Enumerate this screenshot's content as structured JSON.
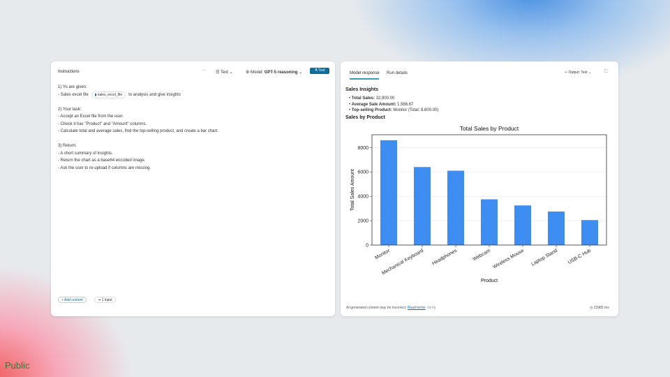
{
  "left": {
    "title": "Instructions",
    "more": "···",
    "format": "Text",
    "model_label": "Model:",
    "model": "GPT-5 reasoning",
    "test": "Test",
    "lines": [
      "1) Yo are given:",
      "- Sales excel file",
      "to analysis and give insights",
      "",
      "2) Your task:",
      "- Accept an Excel file from the user.",
      "- Check it has \"Product\" and \"Amount\" columns.",
      "- Calculate total and average sales, find the top-selling product, and create a bar chart.",
      "",
      "3) Return:",
      "- A short summary of insights.",
      "- Return the chart as a base64 encoded image.",
      "- Ask the user to re-upload if columns are missing."
    ],
    "file_chip": "sales_excel_file",
    "add_content": "Add content",
    "inputs": "1 input"
  },
  "right": {
    "tabs": [
      "Model response",
      "Run details"
    ],
    "output_label": "Output:",
    "output_value": "Text",
    "heading": "Sales Insights",
    "bullets": [
      {
        "k": "Total Sales:",
        "v": "32,900.00"
      },
      {
        "k": "Average Sale Amount:",
        "v": "1,566.67"
      },
      {
        "k": "Top-selling Product:",
        "v": "Monitor (Total: 8,600.00)"
      }
    ],
    "subheading": "Sales by Product",
    "disclaimer": "AI-generated content may be incorrect.",
    "read_terms": "Read terms",
    "time": "23985 ms"
  },
  "chart_data": {
    "type": "bar",
    "title": "Total Sales by Product",
    "xlabel": "Product",
    "ylabel": "Total Sales Amount",
    "categories": [
      "Monitor",
      "Mechanical Keyboard",
      "Headphones",
      "Webcam",
      "Wireless Mouse",
      "Laptop Stand",
      "USB-C Hub"
    ],
    "values": [
      8600,
      6400,
      6100,
      3750,
      3250,
      2750,
      2050
    ],
    "ylim": [
      0,
      9050
    ],
    "yticks": [
      0,
      2000,
      4000,
      6000,
      8000
    ],
    "color": "#3d8ef0"
  },
  "watermark": "Public"
}
